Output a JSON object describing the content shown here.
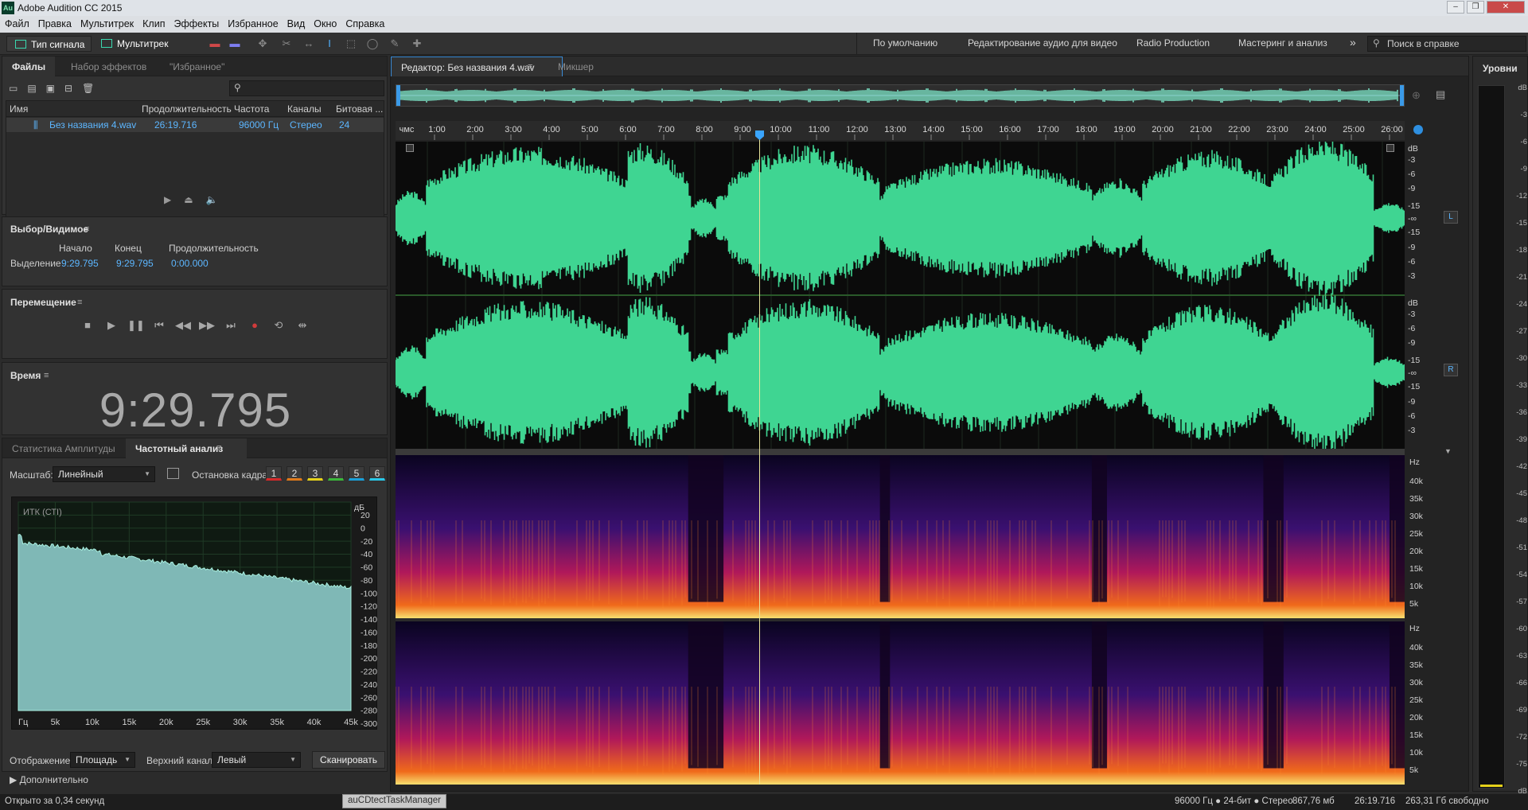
{
  "app": {
    "title": "Adobe Audition CC 2015",
    "logo": "Au"
  },
  "menu": [
    "Файл",
    "Правка",
    "Мультитрек",
    "Клип",
    "Эффекты",
    "Избранное",
    "Вид",
    "Окно",
    "Справка"
  ],
  "toolbar": {
    "mode_waveform": "Тип сигнала",
    "mode_multitrack": "Мультитрек",
    "workspaces": [
      "По умолчанию",
      "Редактирование аудио для видео",
      "Radio Production",
      "Мастеринг и анализ"
    ],
    "more": "»",
    "search_placeholder": "Поиск в справке"
  },
  "files": {
    "tabs": [
      "Файлы",
      "Набор эффектов",
      "\"Избранное\""
    ],
    "columns": [
      "Имя",
      "Продолжительность",
      "Частота",
      "Каналы",
      "Битовая ..."
    ],
    "rows": [
      {
        "name": "Без названия 4.wav",
        "duration": "26:19.716",
        "rate": "96000 Гц",
        "channels": "Стерео",
        "bits": "24"
      }
    ]
  },
  "selection": {
    "title": "Выбор/Видимое",
    "h_start": "Начало",
    "h_end": "Конец",
    "h_duration": "Продолжительность",
    "row_label": "Выделение",
    "start": "9:29.795",
    "end": "9:29.795",
    "duration": "0:00.000"
  },
  "transport": {
    "title": "Перемещение"
  },
  "time": {
    "title": "Время",
    "value": "9:29.795"
  },
  "analysis": {
    "tab_amp": "Статистика Амплитуды",
    "tab_freq": "Частотный анализ",
    "scale_label": "Масштаб:",
    "scale_value": "Линейный",
    "freeze_label": "Остановка кадра:",
    "freeze_buttons": [
      "1",
      "2",
      "3",
      "4",
      "5",
      "6"
    ],
    "freeze_colors": [
      "#d42a2a",
      "#e07a1a",
      "#e6d21a",
      "#3bb83b",
      "#1aa0d8",
      "#2ac8e8"
    ],
    "graph_label": "ИТК (СТI)",
    "db_unit": "дБ",
    "db_ticks": [
      "20",
      "0",
      "-20",
      "-40",
      "-60",
      "-80",
      "-100",
      "-120",
      "-140",
      "-160",
      "-180",
      "-200",
      "-220",
      "-240",
      "-260",
      "-280",
      "-300"
    ],
    "freq_ticks": [
      "Гц",
      "5k",
      "10k",
      "15k",
      "20k",
      "25k",
      "30k",
      "35k",
      "40k",
      "45k"
    ],
    "display_label": "Отображение:",
    "display_value": "Площадь",
    "channel_label": "Верхний канал:",
    "channel_value": "Левый",
    "scan_button": "Сканировать",
    "advanced": "Дополнительно"
  },
  "editor": {
    "tab": "Редактор: Без названия 4.wav",
    "tab_mixer": "Микшер",
    "ruler": [
      "чмс",
      "1:00",
      "2:00",
      "3:00",
      "4:00",
      "5:00",
      "6:00",
      "7:00",
      "8:00",
      "9:00",
      "10:00",
      "11:00",
      "12:00",
      "13:00",
      "14:00",
      "15:00",
      "16:00",
      "17:00",
      "18:00",
      "19:00",
      "20:00",
      "21:00",
      "22:00",
      "23:00",
      "24:00",
      "25:00",
      "26:00"
    ],
    "db_scale": [
      "dB",
      "-3",
      "-6",
      "-9",
      "-15",
      "-∞",
      "-15",
      "-9",
      "-6",
      "-3"
    ],
    "hz_scale": [
      "Hz",
      "40k",
      "35k",
      "30k",
      "25k",
      "20k",
      "15k",
      "10k",
      "5k"
    ],
    "ch_left": "L",
    "ch_right": "R",
    "waveform_color": "#3fd592",
    "playhead_time": "9:29.795"
  },
  "levels": {
    "title": "Уровни",
    "ticks": [
      "dB",
      "-3",
      "-6",
      "-9",
      "-12",
      "-15",
      "-18",
      "-21",
      "-24",
      "-27",
      "-30",
      "-33",
      "-36",
      "-39",
      "-42",
      "-45",
      "-48",
      "-51",
      "-54",
      "-57",
      "-60",
      "-63",
      "-66",
      "-69",
      "-72",
      "-75",
      "dB"
    ]
  },
  "status": {
    "left": "Открыто за 0,34 секунд",
    "task": "auCDtectTaskManager",
    "format": "96000 Гц ● 24-бит ● Стерео",
    "size": "867,76 мб",
    "duration": "26:19.716",
    "free": "263,31 Гб свободно"
  }
}
